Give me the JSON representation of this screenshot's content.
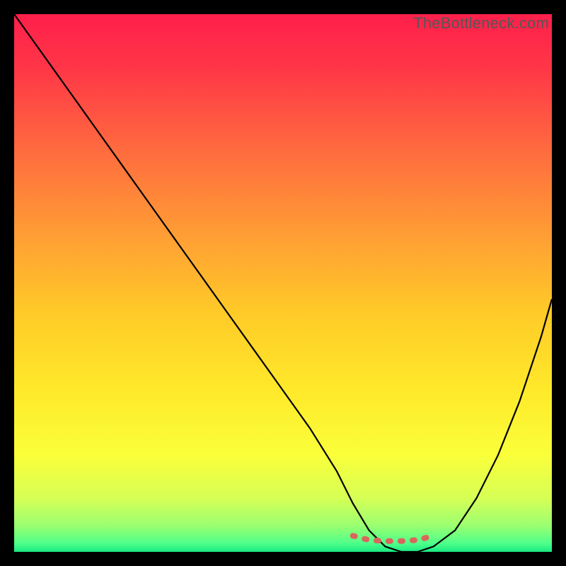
{
  "watermark": "TheBottleneck.com",
  "chart_data": {
    "type": "line",
    "title": "",
    "xlabel": "",
    "ylabel": "",
    "xlim": [
      0,
      100
    ],
    "ylim": [
      0,
      100
    ],
    "grid": false,
    "series": [
      {
        "name": "bottleneck-curve",
        "color": "#000000",
        "x": [
          0,
          5,
          10,
          15,
          20,
          25,
          30,
          35,
          40,
          45,
          50,
          55,
          60,
          63,
          66,
          69,
          72,
          75,
          78,
          82,
          86,
          90,
          94,
          98,
          100
        ],
        "y": [
          100,
          93,
          86,
          79,
          72,
          65,
          58,
          51,
          44,
          37,
          30,
          23,
          15,
          9,
          4,
          1,
          0,
          0,
          1,
          4,
          10,
          18,
          28,
          40,
          47
        ]
      },
      {
        "name": "optimal-range-marker",
        "color": "#d9655c",
        "x": [
          63,
          66,
          69,
          72,
          75,
          78
        ],
        "y": [
          3.0,
          2.2,
          2.0,
          2.0,
          2.2,
          3.0
        ]
      }
    ],
    "background_gradient": {
      "stops": [
        {
          "offset": 0.0,
          "color": "#ff1f4b"
        },
        {
          "offset": 0.1,
          "color": "#ff3647"
        },
        {
          "offset": 0.25,
          "color": "#ff6a3f"
        },
        {
          "offset": 0.4,
          "color": "#ff9a35"
        },
        {
          "offset": 0.55,
          "color": "#ffc928"
        },
        {
          "offset": 0.7,
          "color": "#ffe92a"
        },
        {
          "offset": 0.82,
          "color": "#faff3a"
        },
        {
          "offset": 0.9,
          "color": "#d6ff55"
        },
        {
          "offset": 0.95,
          "color": "#9dff70"
        },
        {
          "offset": 0.985,
          "color": "#4cff8a"
        },
        {
          "offset": 1.0,
          "color": "#18e880"
        }
      ]
    }
  }
}
